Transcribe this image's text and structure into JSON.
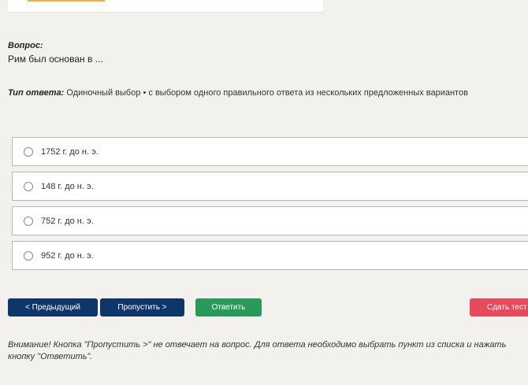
{
  "question": {
    "label": "Вопрос:",
    "text": "Рим был основан в ..."
  },
  "answer_type": {
    "label": "Тип ответа:",
    "value": "Одиночный выбор • с выбором одного правильного ответа из нескольких предложенных вариантов"
  },
  "options": [
    {
      "label": "1752 г. до н. э."
    },
    {
      "label": "148 г. до н. э."
    },
    {
      "label": "752 г. до н. э."
    },
    {
      "label": "952 г. до н. э."
    }
  ],
  "buttons": {
    "prev": "< Предыдущий",
    "skip": "Пропустить >",
    "answer": "Ответить",
    "submit": "Сдать тест"
  },
  "warning": "Внимание! Кнопка \"Пропустить >\" не отвечает на вопрос. Для ответа необходимо выбрать пункт из списка и нажать кнопку \"Ответить\"."
}
